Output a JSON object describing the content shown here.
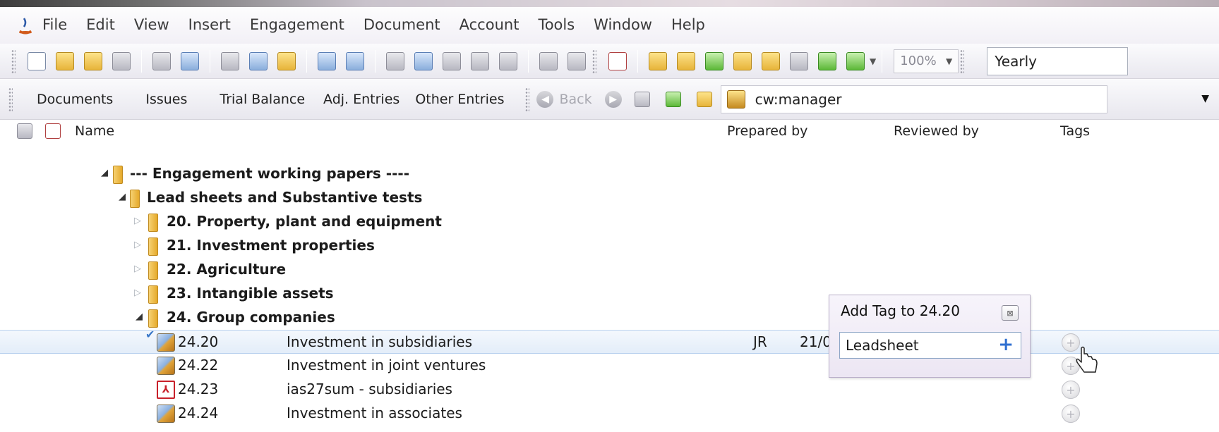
{
  "menu": {
    "items": [
      "File",
      "Edit",
      "View",
      "Insert",
      "Engagement",
      "Document",
      "Account",
      "Tools",
      "Window",
      "Help"
    ]
  },
  "toolbar": {
    "zoom_value": "100%",
    "period_value": "Yearly"
  },
  "nav": {
    "tabs": [
      "Documents",
      "Issues",
      "Trial Balance",
      "Adj. Entries",
      "Other Entries"
    ],
    "back_label": "Back",
    "address_value": "cw:manager"
  },
  "columns": {
    "name": "Name",
    "prepared_by": "Prepared by",
    "reviewed_by": "Reviewed by",
    "tags": "Tags"
  },
  "tree": {
    "rows": [
      {
        "label": "--- Engagement working papers ----",
        "expanded": true
      },
      {
        "label": "Lead sheets and Substantive tests",
        "expanded": true
      },
      {
        "label": "20.  Property, plant and equipment",
        "expanded": false
      },
      {
        "label": "21.  Investment properties",
        "expanded": false
      },
      {
        "label": "22.  Agriculture",
        "expanded": false
      },
      {
        "label": "23.  Intangible assets",
        "expanded": false
      },
      {
        "label": "24.  Group companies",
        "expanded": true
      }
    ],
    "documents": [
      {
        "code": "24.20",
        "description": "Investment in subsidiaries",
        "prepared_by": "JR",
        "date": "21/0",
        "selected": true,
        "checked": true
      },
      {
        "code": "24.22",
        "description": "Investment in joint ventures",
        "prepared_by": "",
        "date": "",
        "selected": false
      },
      {
        "code": "24.23",
        "description": "ias27sum - subsidiaries",
        "prepared_by": "",
        "date": "",
        "selected": false,
        "type": "pdf"
      },
      {
        "code": "24.24",
        "description": "Investment in associates",
        "prepared_by": "",
        "date": "",
        "selected": false
      }
    ]
  },
  "popup": {
    "title": "Add Tag to 24.20",
    "input_value": "Leadsheet",
    "add_symbol": "+",
    "close_symbol": "⊠"
  },
  "colors": {
    "selection": "#e3edf9",
    "popup_bg": "#f1ecf7",
    "accent": "#2f6fd0"
  }
}
